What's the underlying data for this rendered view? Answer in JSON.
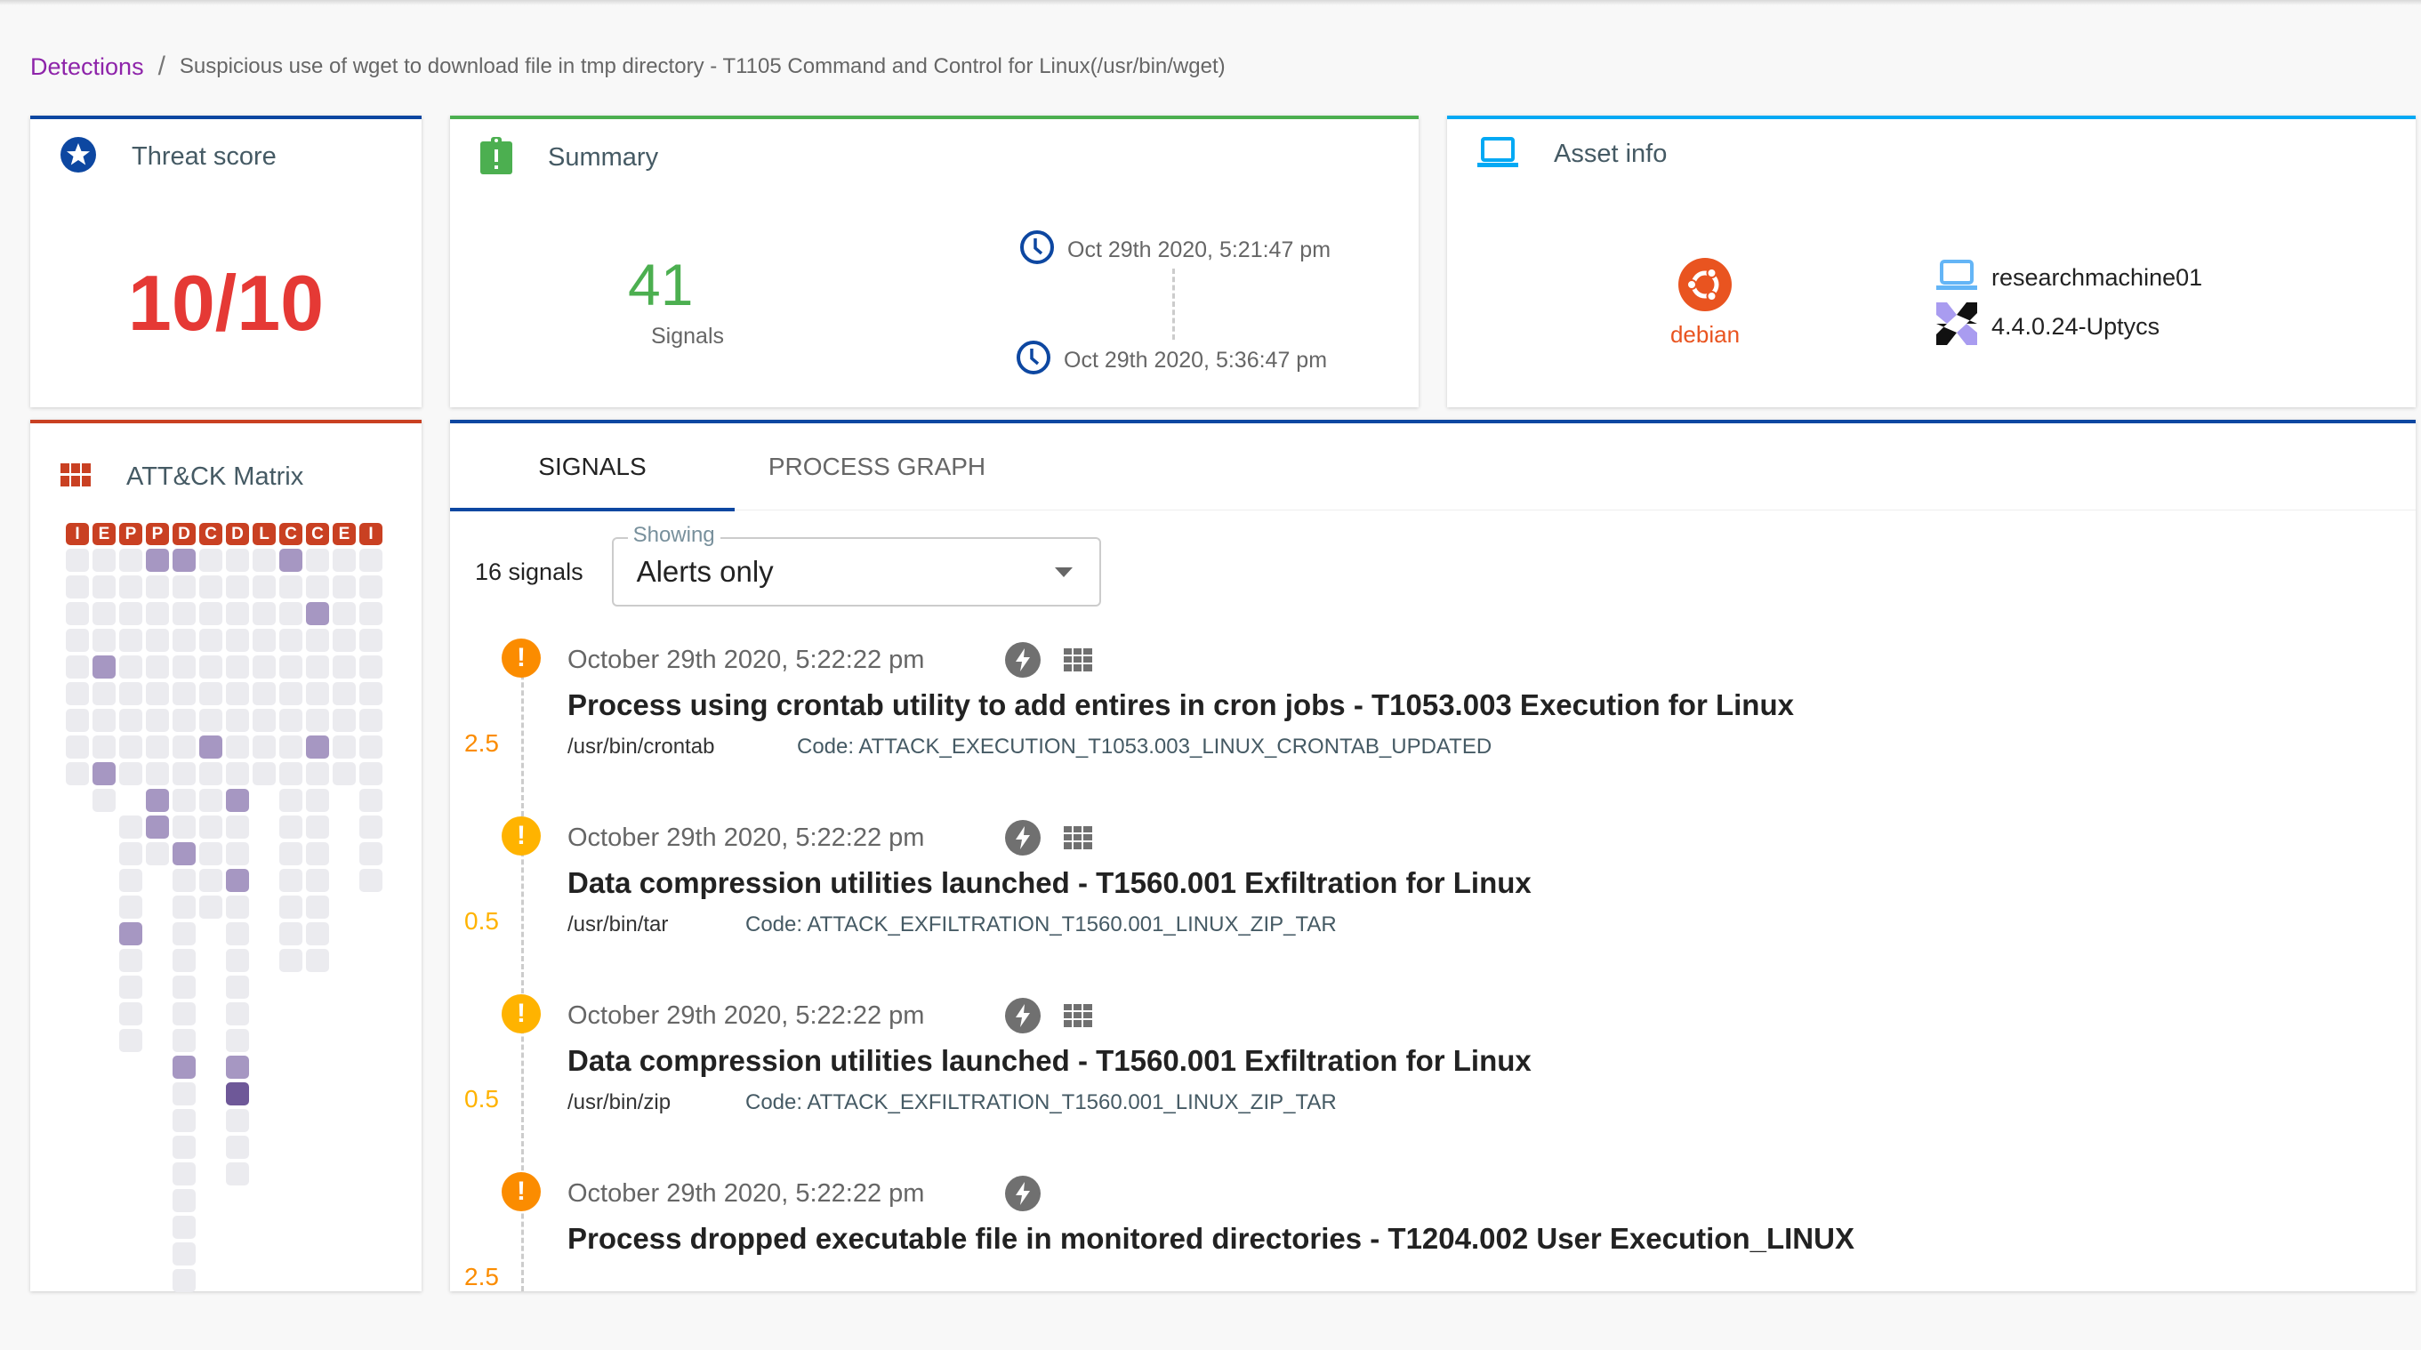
{
  "breadcrumb": {
    "root": "Detections",
    "separator": "/",
    "current": "Suspicious use of wget to download file in tmp directory - T1105 Command and Control for Linux(/usr/bin/wget)"
  },
  "colors": {
    "threat_accent": "#0d47a1",
    "summary_accent": "#4caf50",
    "asset_accent": "#03a9f4",
    "attack_accent": "#c94022",
    "signals_accent": "#0d47a1",
    "score_color": "#e53935",
    "alert_orange": "#fb8c00",
    "alert_amber": "#ffb300",
    "matrix_highlight": "#a697c2",
    "matrix_dark": "#6e5898"
  },
  "threat": {
    "title": "Threat score",
    "icon": "star-circle-icon",
    "score": "10/10"
  },
  "summary": {
    "title": "Summary",
    "icon": "clipboard-alert-icon",
    "signal_count": "41",
    "signal_label": "Signals",
    "start_time": "Oct 29th 2020, 5:21:47 pm",
    "end_time": "Oct 29th 2020, 5:36:47 pm"
  },
  "asset": {
    "title": "Asset info",
    "icon": "laptop-icon",
    "os_name": "debian",
    "os_icon": "ubuntu-logo-icon",
    "hostname": "researchmachine01",
    "agent_version": "4.4.0.24-Uptycs"
  },
  "attack_matrix": {
    "title": "ATT&CK Matrix",
    "icon": "grid-icon",
    "tactics": [
      "I",
      "E",
      "P",
      "P",
      "D",
      "C",
      "D",
      "L",
      "C",
      "C",
      "E",
      "I"
    ],
    "columns": [
      {
        "rows": 9,
        "highlighted": [],
        "dark": []
      },
      {
        "rows": 10,
        "highlighted": [
          4,
          8
        ],
        "dark": []
      },
      {
        "rows": 18,
        "highlighted": [
          14
        ],
        "dark": []
      },
      {
        "rows": 12,
        "highlighted": [
          0,
          9,
          10
        ],
        "dark": []
      },
      {
        "rows": 28,
        "highlighted": [
          0,
          11,
          19
        ],
        "dark": []
      },
      {
        "rows": 14,
        "highlighted": [
          7
        ],
        "dark": []
      },
      {
        "rows": 24,
        "highlighted": [
          9,
          12,
          19
        ],
        "dark": [
          20
        ]
      },
      {
        "rows": 9,
        "highlighted": [],
        "dark": []
      },
      {
        "rows": 16,
        "highlighted": [
          0
        ],
        "dark": []
      },
      {
        "rows": 16,
        "highlighted": [
          2,
          7
        ],
        "dark": []
      },
      {
        "rows": 9,
        "highlighted": [],
        "dark": []
      },
      {
        "rows": 13,
        "highlighted": [],
        "dark": []
      }
    ],
    "column_gaps": {
      "2": [
        9
      ],
      "3": [],
      "5": [],
      "6": []
    }
  },
  "signals_panel": {
    "tabs": [
      {
        "label": "SIGNALS",
        "active": true
      },
      {
        "label": "PROCESS GRAPH",
        "active": false
      }
    ],
    "count_text": "16 signals",
    "filter": {
      "legend": "Showing",
      "value": "Alerts only"
    },
    "items": [
      {
        "time": "October 29th 2020, 5:22:22 pm",
        "title": "Process using crontab utility to add entires in cron jobs - T1053.003 Execution for Linux",
        "path": "/usr/bin/crontab",
        "code": "Code: ATTACK_EXECUTION_T1053.003_LINUX_CRONTAB_UPDATED",
        "score": "2.5",
        "severity": "orange",
        "has_matrix_icon": true
      },
      {
        "time": "October 29th 2020, 5:22:22 pm",
        "title": "Data compression utilities launched - T1560.001 Exfiltration for Linux",
        "path": "/usr/bin/tar",
        "code": "Code: ATTACK_EXFILTRATION_T1560.001_LINUX_ZIP_TAR",
        "score": "0.5",
        "severity": "amber",
        "has_matrix_icon": true
      },
      {
        "time": "October 29th 2020, 5:22:22 pm",
        "title": "Data compression utilities launched - T1560.001 Exfiltration for Linux",
        "path": "/usr/bin/zip",
        "code": "Code: ATTACK_EXFILTRATION_T1560.001_LINUX_ZIP_TAR",
        "score": "0.5",
        "severity": "amber",
        "has_matrix_icon": true
      },
      {
        "time": "October 29th 2020, 5:22:22 pm",
        "title": "Process dropped executable file in monitored directories - T1204.002 User Execution_LINUX",
        "path": "",
        "code": "",
        "score": "2.5",
        "severity": "orange",
        "has_matrix_icon": false
      }
    ]
  }
}
